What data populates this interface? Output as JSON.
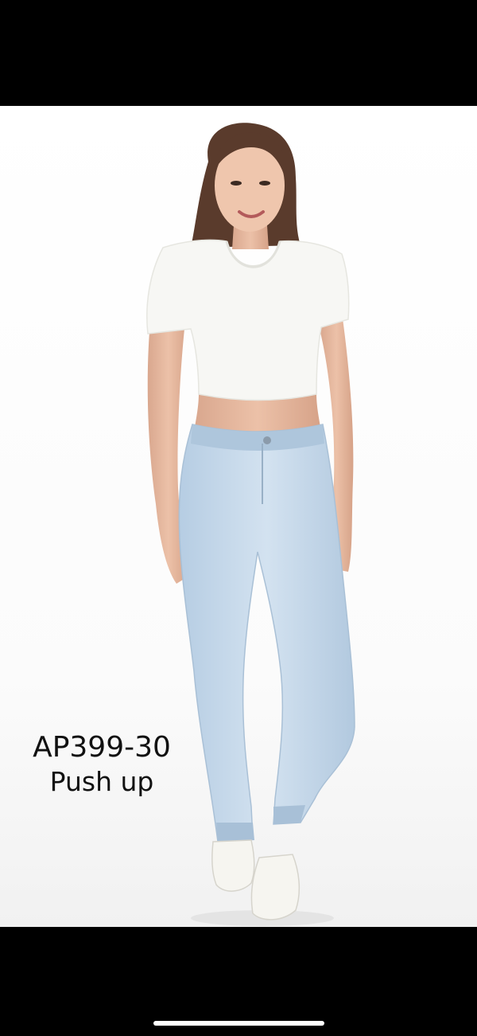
{
  "product": {
    "code": "AP399-30",
    "feature": "Push up"
  },
  "colors": {
    "letterbox": "#000000",
    "background": "#ffffff",
    "denim": "#c3d7ea",
    "top": "#f7f7f4",
    "text": "#111111",
    "home_indicator": "#ffffff"
  },
  "icons": {
    "home_indicator": "home-indicator-bar"
  }
}
